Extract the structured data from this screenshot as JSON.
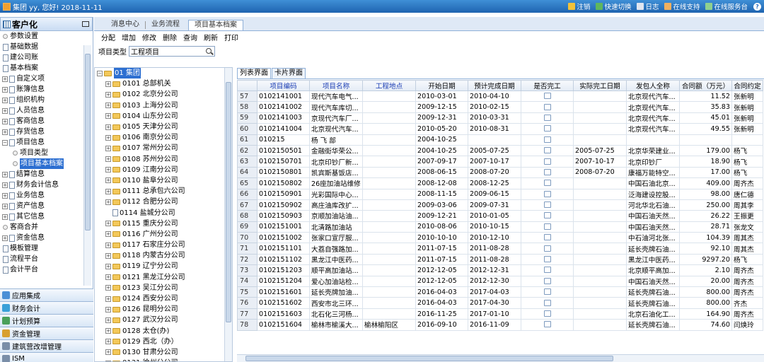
{
  "topbar": {
    "greeting": "集团 yy, 您好! 2018-11-11",
    "tools": [
      "注销",
      "快速切换",
      "日志",
      "在线支持",
      "在线服务台"
    ]
  },
  "sidebar": {
    "title": "客户化",
    "items": [
      {
        "label": "参数设置",
        "kind": "leaf-dot"
      },
      {
        "label": "基础数据",
        "kind": "doc"
      },
      {
        "label": "建公司账",
        "kind": "doc"
      },
      {
        "label": "基本档案",
        "kind": "doc"
      },
      {
        "label": "自定义项",
        "kind": "exp"
      },
      {
        "label": "账簿信息",
        "kind": "exp"
      },
      {
        "label": "组织机构",
        "kind": "exp"
      },
      {
        "label": "人员信息",
        "kind": "exp"
      },
      {
        "label": "客商信息",
        "kind": "exp"
      },
      {
        "label": "存货信息",
        "kind": "exp"
      },
      {
        "label": "项目信息",
        "kind": "open"
      },
      {
        "label": "项目类型",
        "kind": "child"
      },
      {
        "label": "项目基本档案",
        "kind": "child-selected"
      },
      {
        "label": "结算信息",
        "kind": "exp"
      },
      {
        "label": "财务会计信息",
        "kind": "exp"
      },
      {
        "label": "业务信息",
        "kind": "exp"
      },
      {
        "label": "资产信息",
        "kind": "exp"
      },
      {
        "label": "其它信息",
        "kind": "exp"
      },
      {
        "label": "客商合并",
        "kind": "leaf-dot"
      },
      {
        "label": "资金信息",
        "kind": "exp"
      },
      {
        "label": "模板管理",
        "kind": "doc"
      },
      {
        "label": "流程平台",
        "kind": "doc"
      },
      {
        "label": "会计平台",
        "kind": "doc"
      }
    ],
    "accordion": [
      {
        "label": "应用集成",
        "color": "#4a8fd6"
      },
      {
        "label": "财务会计",
        "color": "#3aa0d8"
      },
      {
        "label": "计划预算",
        "color": "#4aa05a"
      },
      {
        "label": "资金管理",
        "color": "#d8a030"
      },
      {
        "label": "建筑营改增管理",
        "color": "#7a8ea8"
      },
      {
        "label": "ISM",
        "color": "#7a8ea8"
      },
      {
        "label": "流程中心",
        "color": "#3a7fc8"
      }
    ]
  },
  "main": {
    "tabs": [
      "消息中心",
      "业务流程",
      "项目基本档案"
    ],
    "toolbar": [
      "分配",
      "增加",
      "修改",
      "删除",
      "查询",
      "刷新",
      "打印"
    ],
    "filter": {
      "label": "项目类型",
      "value": "工程项目"
    },
    "orgtree": [
      "01 集团",
      "0101 总部机关",
      "0102 北京分公司",
      "0103 上海分公司",
      "0104 山东分公司",
      "0105 天津分公司",
      "0106 南京分公司",
      "0107 常州分公司",
      "0108 苏州分公司",
      "0109 江南分公司",
      "0110 盐阜分公司",
      "0111 总承包六公司",
      "0112 合肥分公司",
      "0114 盐城分公司",
      "0115 重庆分公司",
      "0116 广州分公司",
      "0117 石家庄分公司",
      "0118 内蒙古分公司",
      "0119 辽宁分公司",
      "0121 黑龙江分公司",
      "0123 吴江分公司",
      "0124 西安分公司",
      "0126 昆明分公司",
      "0127 武汉分公司",
      "0128 太仓(办)",
      "0129 西北（办）",
      "0130 甘肃分公司",
      "0131 徐州分公司"
    ],
    "subtabs": [
      "列表界面",
      "卡片界面"
    ],
    "columns": [
      "",
      "项目编码",
      "项目名称",
      "工程地点",
      "开始日期",
      "预计完成日期",
      "是否完工",
      "实际完工日期",
      "发包人全称",
      "合同额（万元）",
      "合同约定"
    ],
    "rows": [
      [
        "57",
        "0102141001",
        "现代汽车电气...",
        "",
        "2010-03-01",
        "2010-04-10",
        "",
        "",
        "北京现代汽车...",
        "11.52",
        "张新明"
      ],
      [
        "58",
        "0102141002",
        "现代汽车库切...",
        "",
        "2009-12-15",
        "2010-02-15",
        "",
        "",
        "北京现代汽车...",
        "35.83",
        "张新明"
      ],
      [
        "59",
        "0102141003",
        "京现代汽车厂...",
        "",
        "2009-12-31",
        "2010-03-31",
        "",
        "",
        "北京现代汽车...",
        "45.01",
        "张新明"
      ],
      [
        "60",
        "0102141004",
        "北京现代汽车...",
        "",
        "2010-05-20",
        "2010-08-31",
        "",
        "",
        "北京现代汽车...",
        "49.55",
        "张新明"
      ],
      [
        "61",
        "010215",
        "杨 飞 部",
        "",
        "2004-10-25",
        "",
        "",
        "",
        "",
        "",
        ""
      ],
      [
        "62",
        "0102150501",
        "金融街华荣公...",
        "",
        "2004-10-25",
        "2005-07-25",
        "",
        "2005-07-25",
        "北京华荣建业...",
        "179.00",
        "杨飞"
      ],
      [
        "63",
        "0102150701",
        "北京印钞厂新...",
        "",
        "2007-09-17",
        "2007-10-17",
        "",
        "2007-10-17",
        "北京印钞厂",
        "18.90",
        "杨飞"
      ],
      [
        "64",
        "0102150801",
        "凯宾斯基饭店...",
        "",
        "2008-06-15",
        "2008-07-20",
        "",
        "2008-07-20",
        "康福万能特空...",
        "17.00",
        "杨飞"
      ],
      [
        "65",
        "0102150802",
        "26座加油站维修",
        "",
        "2008-12-08",
        "2008-12-25",
        "",
        "",
        "中国石油北京...",
        "409.00",
        "周齐杰"
      ],
      [
        "66",
        "0102150901",
        "光彩国际中心...",
        "",
        "2008-11-15",
        "2009-06-15",
        "",
        "",
        "泛海建设控股...",
        "98.00",
        "唐仁德"
      ],
      [
        "67",
        "0102150902",
        "高庄油库改扩...",
        "",
        "2009-03-06",
        "2009-07-31",
        "",
        "",
        "河北华北石油...",
        "250.00",
        "周其李"
      ],
      [
        "68",
        "0102150903",
        "京顺加油站油...",
        "",
        "2009-12-21",
        "2010-01-05",
        "",
        "",
        "中国石油天然...",
        "26.22",
        "王振更"
      ],
      [
        "69",
        "0102151001",
        "北清路加油站",
        "",
        "2010-08-06",
        "2010-10-15",
        "",
        "",
        "中国石油天然...",
        "28.71",
        "张龙文"
      ],
      [
        "70",
        "0102151002",
        "张家口宣厅服...",
        "",
        "2010-10-10",
        "2010-12-10",
        "",
        "",
        "中石油河北张...",
        "104.39",
        "周其杰"
      ],
      [
        "71",
        "0102151101",
        "大荔自强路加...",
        "",
        "2011-07-15",
        "2011-08-28",
        "",
        "",
        "延长壳牌石油...",
        "92.10",
        "周其杰"
      ],
      [
        "72",
        "0102151102",
        "黑龙江中医药...",
        "",
        "2011-07-15",
        "2011-08-28",
        "",
        "",
        "黑龙江中医药...",
        "9297.20",
        "杨飞"
      ],
      [
        "73",
        "0102151203",
        "顺平高加油站...",
        "",
        "2012-12-05",
        "2012-12-31",
        "",
        "",
        "北京顺平高加...",
        "2.10",
        "周齐杰"
      ],
      [
        "74",
        "0102151204",
        "爱心加油站检...",
        "",
        "2012-12-05",
        "2012-12-30",
        "",
        "",
        "中国石油天然...",
        "20.00",
        "周齐杰"
      ],
      [
        "75",
        "0102151601",
        "延长壳牌加油...",
        "",
        "2016-04-03",
        "2017-04-03",
        "",
        "",
        "延长壳牌石油...",
        "800.00",
        "周齐杰"
      ],
      [
        "76",
        "0102151602",
        "西安市北三环...",
        "",
        "2016-04-03",
        "2017-04-30",
        "",
        "",
        "延长壳牌石油...",
        "800.00",
        "齐杰"
      ],
      [
        "77",
        "0102151603",
        "北石化三河杨...",
        "",
        "2016-11-25",
        "2017-01-10",
        "",
        "",
        "北京石油化工...",
        "164.90",
        "周齐杰"
      ],
      [
        "78",
        "0102151604",
        "榆林市榆溪大...",
        "榆林榆阳区",
        "2016-09-10",
        "2016-11-09",
        "",
        "",
        "延长壳牌石油...",
        "74.60",
        "闫焕玲"
      ]
    ]
  }
}
